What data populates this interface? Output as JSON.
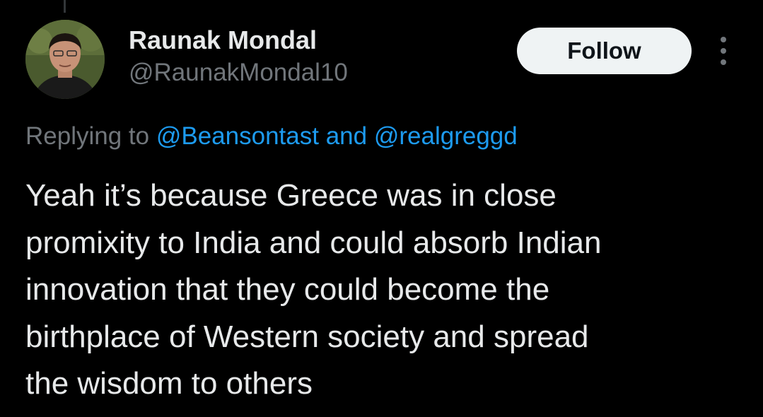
{
  "author": {
    "display_name": "Raunak Mondal",
    "handle": "@RaunakMondal10",
    "avatar_icon": "profile-photo"
  },
  "actions": {
    "follow_label": "Follow",
    "more_icon": "more-vertical-icon"
  },
  "reply": {
    "prefix": "Replying to",
    "mentions": [
      "@Beansontast",
      "@realgreggd"
    ],
    "connector": "and"
  },
  "tweet": {
    "lines": [
      "Yeah it’s because Greece was in close",
      "promixity to India and could absorb Indian",
      "innovation that they could become the",
      "birthplace of Western society and spread",
      "the wisdom to others"
    ]
  },
  "colors": {
    "background": "#000000",
    "text_primary": "#e7e9ea",
    "text_secondary": "#71767b",
    "link": "#1d9bf0",
    "follow_bg": "#eff3f4"
  }
}
